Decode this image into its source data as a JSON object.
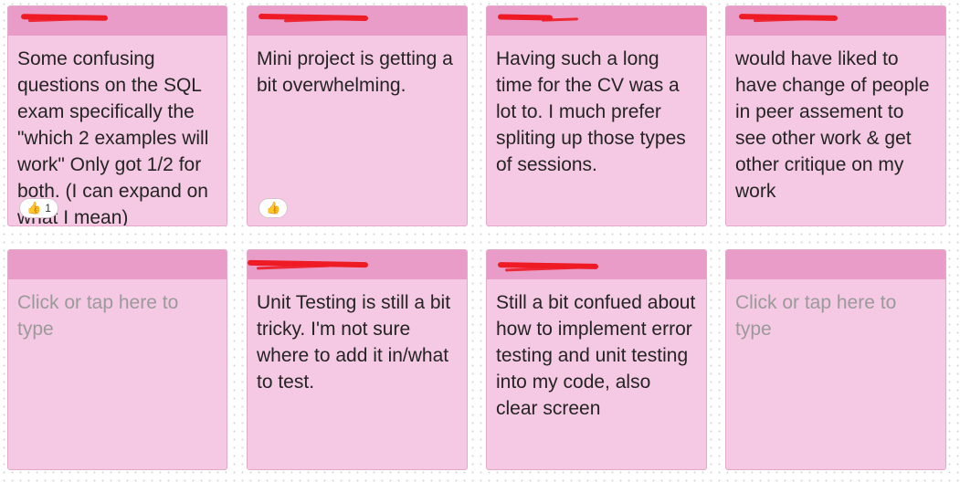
{
  "notes": [
    {
      "author": "",
      "text": "Some confusing questions on the SQL exam specifically the \"which 2 examples will work\" Only got 1/2 for both. (I can expand on what I mean)",
      "placeholder": false,
      "reaction": {
        "icon": "👍",
        "count": "1"
      }
    },
    {
      "author": "",
      "text": "Mini project is getting a bit overwhelming.",
      "placeholder": false,
      "reaction": {
        "icon": "👍",
        "count": ""
      }
    },
    {
      "author": "",
      "text": "Having such a long time for the CV was a lot to. I much prefer spliting up those types of sessions.",
      "placeholder": false
    },
    {
      "author": "",
      "text": "would have liked to have change of people in peer assement to see other work & get other critique on my work",
      "placeholder": false
    },
    {
      "author": "",
      "text": "Click or tap here to type",
      "placeholder": true
    },
    {
      "author": "",
      "text": "Unit Testing is still a bit tricky. I'm not sure where to add it in/what to test.",
      "placeholder": false
    },
    {
      "author": "",
      "text": "Still a bit confued about how to implement error testing and unit testing into my code, also clear screen",
      "placeholder": false
    },
    {
      "author": "",
      "text": "Click or tap here to type",
      "placeholder": true
    }
  ],
  "colors": {
    "note_body": "#f5c9e3",
    "note_header": "#ea9cc8",
    "redaction": "#ee1b24"
  }
}
